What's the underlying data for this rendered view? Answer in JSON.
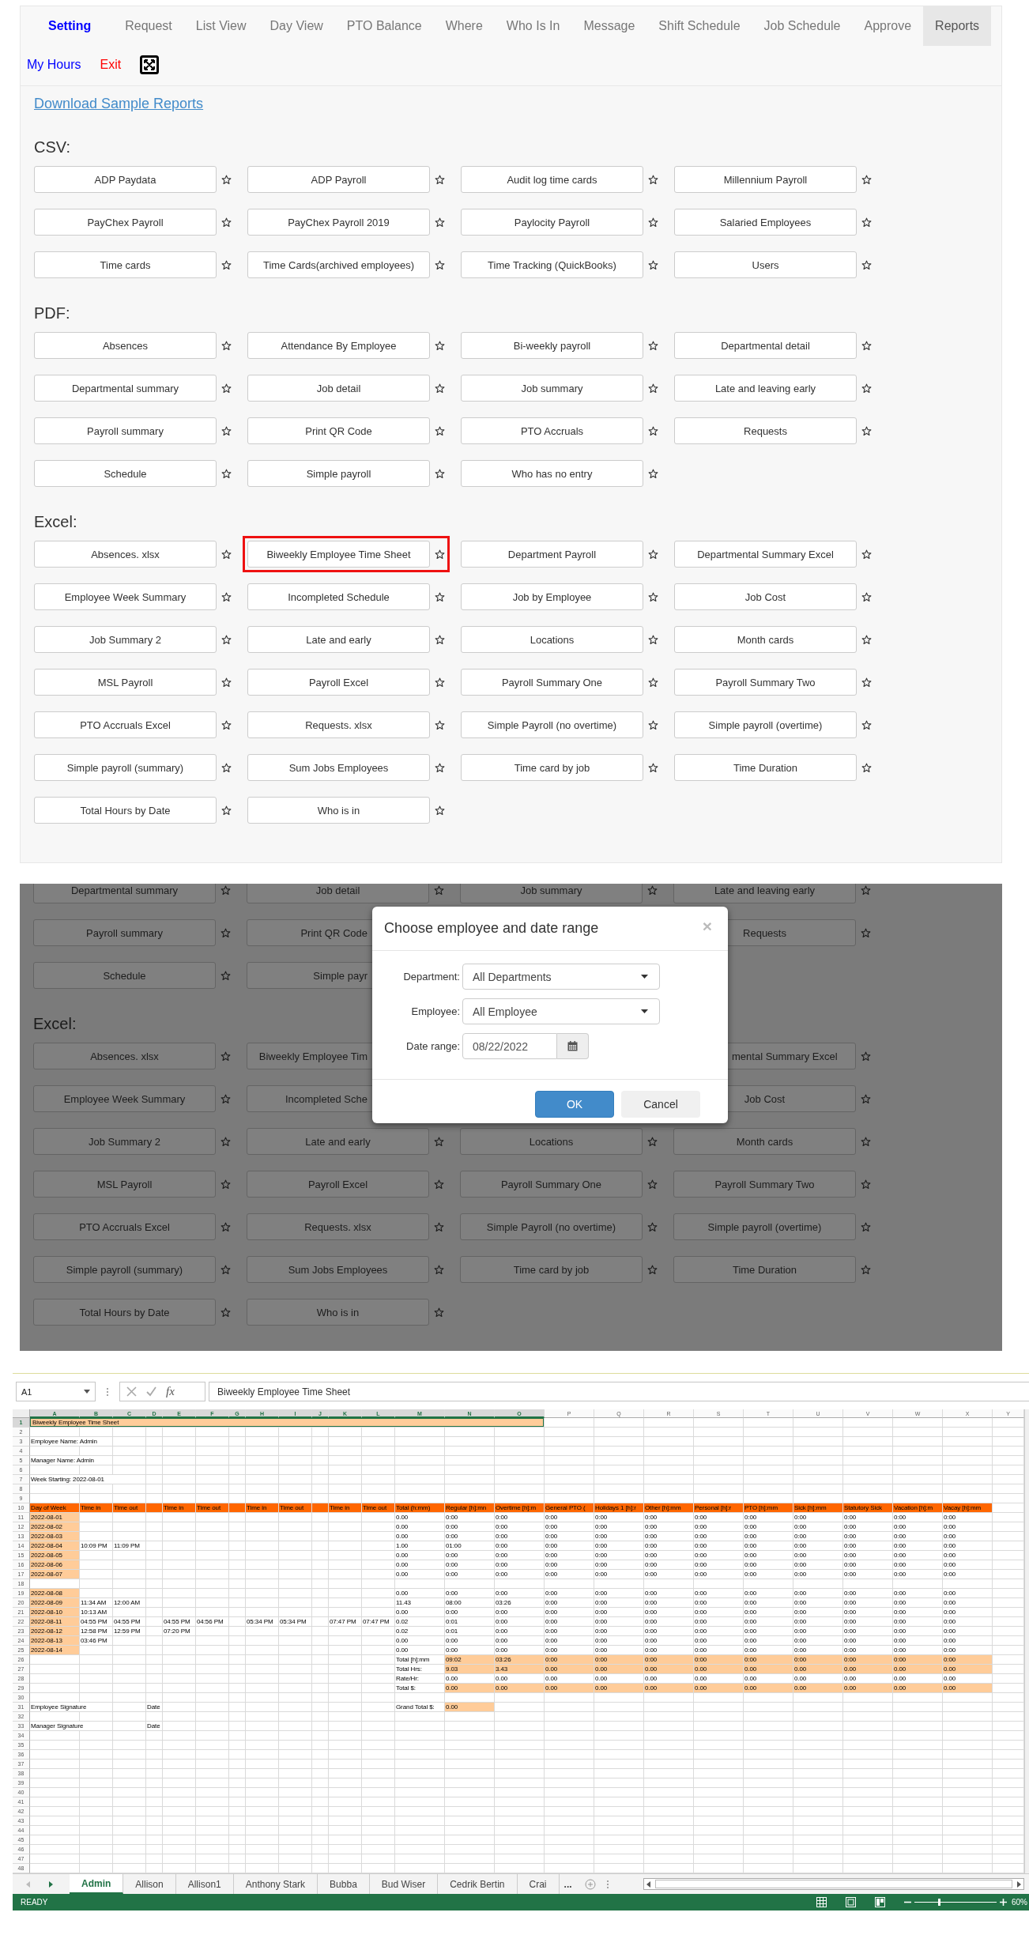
{
  "nav": {
    "tabs": [
      {
        "label": "Setting",
        "kind": "brand",
        "selected": false
      },
      {
        "label": "Request",
        "kind": "tab",
        "selected": false
      },
      {
        "label": "List View",
        "kind": "tab",
        "selected": false
      },
      {
        "label": "Day View",
        "kind": "tab",
        "selected": false
      },
      {
        "label": "PTO Balance",
        "kind": "tab",
        "selected": false
      },
      {
        "label": "Where",
        "kind": "tab",
        "selected": false
      },
      {
        "label": "Who Is In",
        "kind": "tab",
        "selected": false
      },
      {
        "label": "Message",
        "kind": "tab",
        "selected": false
      },
      {
        "label": "Shift Schedule",
        "kind": "tab",
        "selected": false
      },
      {
        "label": "Job Schedule",
        "kind": "tab",
        "selected": false
      },
      {
        "label": "Approve",
        "kind": "tab",
        "selected": false
      },
      {
        "label": "Reports",
        "kind": "tab",
        "selected": true
      }
    ],
    "links": [
      {
        "label": "My Hours",
        "color": "#0000ff"
      },
      {
        "label": "Exit",
        "color": "#ff0000"
      }
    ]
  },
  "reports_page": {
    "download_link": "Download Sample Reports",
    "sections": [
      {
        "heading": "CSV:",
        "reports": [
          {
            "label": "ADP Paydata"
          },
          {
            "label": "ADP Payroll"
          },
          {
            "label": "Audit log time cards"
          },
          {
            "label": "Millennium Payroll"
          },
          {
            "label": "PayChex Payroll"
          },
          {
            "label": "PayChex Payroll 2019"
          },
          {
            "label": "Paylocity Payroll"
          },
          {
            "label": "Salaried Employees"
          },
          {
            "label": "Time cards"
          },
          {
            "label": "Time Cards(archived employees)"
          },
          {
            "label": "Time Tracking (QuickBooks)"
          },
          {
            "label": "Users"
          }
        ]
      },
      {
        "heading": "PDF:",
        "reports": [
          {
            "label": "Absences"
          },
          {
            "label": "Attendance By Employee"
          },
          {
            "label": "Bi-weekly payroll"
          },
          {
            "label": "Departmental detail"
          },
          {
            "label": "Departmental summary"
          },
          {
            "label": "Job detail"
          },
          {
            "label": "Job summary"
          },
          {
            "label": "Late and leaving early"
          },
          {
            "label": "Payroll summary"
          },
          {
            "label": "Print QR Code"
          },
          {
            "label": "PTO Accruals"
          },
          {
            "label": "Requests"
          },
          {
            "label": "Schedule"
          },
          {
            "label": "Simple payroll"
          },
          {
            "label": "Who has no entry"
          }
        ]
      },
      {
        "heading": "Excel:",
        "reports": [
          {
            "label": "Absences. xlsx",
            "outlined": false
          },
          {
            "label": "Biweekly Employee Time Sheet",
            "outlined": true
          },
          {
            "label": "Department Payroll",
            "outlined": false
          },
          {
            "label": "Departmental Summary Excel",
            "outlined": false
          },
          {
            "label": "Employee Week Summary",
            "outlined": false
          },
          {
            "label": "Incompleted Schedule",
            "outlined": false
          },
          {
            "label": "Job by Employee",
            "outlined": false
          },
          {
            "label": "Job Cost",
            "outlined": false
          },
          {
            "label": "Job Summary 2",
            "outlined": false
          },
          {
            "label": "Late and early",
            "outlined": false
          },
          {
            "label": "Locations",
            "outlined": false
          },
          {
            "label": "Month cards",
            "outlined": false
          },
          {
            "label": "MSL Payroll",
            "outlined": false
          },
          {
            "label": "Payroll Excel",
            "outlined": false
          },
          {
            "label": "Payroll Summary One",
            "outlined": false
          },
          {
            "label": "Payroll Summary Two",
            "outlined": false
          },
          {
            "label": "PTO Accruals Excel",
            "outlined": false
          },
          {
            "label": "Requests. xlsx",
            "outlined": false
          },
          {
            "label": "Simple Payroll (no overtime)",
            "outlined": false
          },
          {
            "label": "Simple payroll (overtime)",
            "outlined": false
          },
          {
            "label": "Simple payroll (summary)",
            "outlined": false
          },
          {
            "label": "Sum Jobs Employees",
            "outlined": false
          },
          {
            "label": "Time card by job",
            "outlined": false
          },
          {
            "label": "Time Duration",
            "outlined": false
          },
          {
            "label": "Total Hours by Date",
            "outlined": false
          },
          {
            "label": "Who is in",
            "outlined": false
          }
        ]
      }
    ]
  },
  "background_page": {
    "sections": [
      {
        "reports": [
          {
            "label": "Departmental summary",
            "kind": "plain"
          },
          {
            "label": "Job detail",
            "kind": "plain"
          },
          {
            "label": "Job summary",
            "kind": "plain"
          },
          {
            "label": "Late and leaving early",
            "kind": "plain"
          },
          {
            "label": "Payroll summary",
            "kind": "plain"
          },
          {
            "label": "Print QR Code",
            "kind": "right-covered"
          },
          {
            "kind": "covered"
          },
          {
            "label": "Requests",
            "kind": "plain"
          },
          {
            "label": "Schedule",
            "kind": "plain"
          },
          {
            "label": "Simple payr",
            "kind": "right-covered"
          },
          {
            "kind": "covered"
          }
        ]
      },
      {
        "heading": "Excel:",
        "reports": [
          {
            "label": "Absences. xlsx",
            "kind": "plain"
          },
          {
            "label": "Biweekly Employee Tim",
            "kind": "right-covered"
          },
          {
            "kind": "covered"
          },
          {
            "label": "mental Summary Excel",
            "kind": "left-covered"
          },
          {
            "label": "Employee Week Summary",
            "kind": "plain"
          },
          {
            "label": "Incompleted Sche",
            "kind": "right-covered"
          },
          {
            "kind": "covered"
          },
          {
            "label": "Job Cost",
            "kind": "plain"
          },
          {
            "label": "Job Summary 2",
            "kind": "plain"
          },
          {
            "label": "Late and early",
            "kind": "plain"
          },
          {
            "label": "Locations",
            "kind": "plain"
          },
          {
            "label": "Month cards",
            "kind": "plain"
          },
          {
            "label": "MSL Payroll",
            "kind": "plain"
          },
          {
            "label": "Payroll Excel",
            "kind": "plain"
          },
          {
            "label": "Payroll Summary One",
            "kind": "plain"
          },
          {
            "label": "Payroll Summary Two",
            "kind": "plain"
          },
          {
            "label": "PTO Accruals Excel",
            "kind": "plain"
          },
          {
            "label": "Requests. xlsx",
            "kind": "plain"
          },
          {
            "label": "Simple Payroll (no overtime)",
            "kind": "plain"
          },
          {
            "label": "Simple payroll (overtime)",
            "kind": "plain"
          },
          {
            "label": "Simple payroll (summary)",
            "kind": "plain"
          },
          {
            "label": "Sum Jobs Employees",
            "kind": "plain"
          },
          {
            "label": "Time card by job",
            "kind": "plain"
          },
          {
            "label": "Time Duration",
            "kind": "plain"
          },
          {
            "label": "Total Hours by Date",
            "kind": "plain"
          },
          {
            "label": "Who is in",
            "kind": "plain"
          }
        ]
      }
    ]
  },
  "dialog": {
    "title": "Choose employee and date range",
    "close": "×",
    "fields": [
      {
        "label": "Department:",
        "kind": "select",
        "value": "All Departments"
      },
      {
        "label": "Employee:",
        "kind": "select",
        "value": "All Employee"
      },
      {
        "label": "Date range:",
        "kind": "date",
        "value": "08/22/2022"
      }
    ],
    "buttons": [
      {
        "label": "OK",
        "kind": "primary"
      },
      {
        "label": "Cancel",
        "kind": "default"
      }
    ]
  },
  "spreadsheet": {
    "name_box": "A1",
    "function_label": "fx",
    "formula": "Biweekly Employee Time Sheet",
    "columns": [
      {
        "label": "A",
        "selected": true
      },
      {
        "label": "B",
        "selected": true
      },
      {
        "label": "C",
        "selected": true
      },
      {
        "label": "D",
        "selected": true
      },
      {
        "label": "E",
        "selected": true
      },
      {
        "label": "F",
        "selected": true
      },
      {
        "label": "G",
        "selected": true
      },
      {
        "label": "H",
        "selected": true
      },
      {
        "label": "I",
        "selected": true
      },
      {
        "label": "J",
        "selected": true
      },
      {
        "label": "K",
        "selected": true
      },
      {
        "label": "L",
        "selected": true
      },
      {
        "label": "M",
        "selected": true
      },
      {
        "label": "N",
        "selected": true
      },
      {
        "label": "O",
        "selected": true
      },
      {
        "label": "P",
        "selected": false
      },
      {
        "label": "Q",
        "selected": false
      },
      {
        "label": "R",
        "selected": false
      },
      {
        "label": "S",
        "selected": false
      },
      {
        "label": "T",
        "selected": false
      },
      {
        "label": "U",
        "selected": false
      },
      {
        "label": "V",
        "selected": false
      },
      {
        "label": "W",
        "selected": false
      },
      {
        "label": "X",
        "selected": false
      },
      {
        "label": "Y",
        "selected": false
      }
    ],
    "rows": [
      {
        "label": "1",
        "selected": true,
        "cells": [
          {
            "text": "Biweekly Employee Time Sheet",
            "color": "#ffcc99",
            "selected": true
          },
          {
            "kind": "merged"
          },
          {
            "kind": "merged"
          },
          {
            "kind": "merged"
          },
          {
            "kind": "merged"
          },
          {
            "kind": "merged"
          },
          {
            "kind": "merged"
          },
          {
            "kind": "merged"
          },
          {
            "kind": "merged"
          },
          {
            "kind": "merged"
          },
          {
            "kind": "merged"
          },
          {
            "kind": "merged"
          },
          {
            "kind": "merged"
          },
          {
            "kind": "merged"
          },
          {
            "kind": "merged"
          }
        ]
      },
      {
        "label": "2",
        "selected": false
      },
      {
        "label": "3",
        "selected": false,
        "cells": [
          {
            "text": "Employee Name: Admin"
          }
        ]
      },
      {
        "label": "4",
        "selected": false
      },
      {
        "label": "5",
        "selected": false,
        "cells": [
          {
            "text": "Manager Name: Admin"
          }
        ]
      },
      {
        "label": "6",
        "selected": false
      },
      {
        "label": "7",
        "selected": false,
        "cells": [
          {
            "text": "Week Starting: 2022-08-01"
          }
        ]
      },
      {
        "label": "8",
        "selected": false
      },
      {
        "label": "9",
        "selected": false
      },
      {
        "label": "10",
        "selected": false,
        "cells": [
          {
            "text": "Day of Week",
            "color": "#ff6600"
          },
          {
            "text": "Time in",
            "color": "#ff6600"
          },
          {
            "text": "Time out",
            "color": "#ff6600"
          },
          {
            "color": "#ff6600"
          },
          {
            "text": "Time in",
            "color": "#ff6600"
          },
          {
            "text": "Time out",
            "color": "#ff6600"
          },
          {
            "color": "#ff6600"
          },
          {
            "text": "Time in",
            "color": "#ff6600"
          },
          {
            "text": "Time out",
            "color": "#ff6600"
          },
          {
            "color": "#ff6600"
          },
          {
            "text": "Time in",
            "color": "#ff6600"
          },
          {
            "text": "Time out",
            "color": "#ff6600"
          },
          {
            "text": "Total (h:mm)",
            "color": "#ff6600"
          },
          {
            "text": "Regular [h]:mn",
            "color": "#ff6600"
          },
          {
            "text": "Overtime [h]:m",
            "color": "#ff6600"
          },
          {
            "text": "General PTO (",
            "color": "#ff6600"
          },
          {
            "text": "Holidays 1 [h]:r",
            "color": "#ff6600"
          },
          {
            "text": "Other [h]:mm",
            "color": "#ff6600"
          },
          {
            "text": "Personal [h]:r",
            "color": "#ff6600"
          },
          {
            "text": "PTO [h]:mm",
            "color": "#ff6600"
          },
          {
            "text": "Sick [h]:mm",
            "color": "#ff6600"
          },
          {
            "text": "Statutory Sick",
            "color": "#ff6600"
          },
          {
            "text": "Vacation [h]:m",
            "color": "#ff6600"
          },
          {
            "text": "Vacay [h]:mm",
            "color": "#ff6600"
          }
        ]
      },
      {
        "label": "11",
        "selected": false,
        "cells": [
          {
            "text": "2022-08-01",
            "color": "#ffcc99"
          },
          null,
          null,
          null,
          null,
          null,
          null,
          null,
          null,
          null,
          null,
          null,
          {
            "text": "0.00"
          },
          {
            "text": "0:00"
          },
          {
            "text": "0:00"
          },
          {
            "text": "0:00"
          },
          {
            "text": "0:00"
          },
          {
            "text": "0:00"
          },
          {
            "text": "0:00"
          },
          {
            "text": "0:00"
          },
          {
            "text": "0:00"
          },
          {
            "text": "0:00"
          },
          {
            "text": "0:00"
          },
          {
            "text": "0:00"
          }
        ]
      },
      {
        "label": "12",
        "selected": false,
        "cells": [
          {
            "text": "2022-08-02",
            "color": "#ffcc99"
          },
          null,
          null,
          null,
          null,
          null,
          null,
          null,
          null,
          null,
          null,
          null,
          {
            "text": "0.00"
          },
          {
            "text": "0:00"
          },
          {
            "text": "0:00"
          },
          {
            "text": "0:00"
          },
          {
            "text": "0:00"
          },
          {
            "text": "0:00"
          },
          {
            "text": "0:00"
          },
          {
            "text": "0:00"
          },
          {
            "text": "0:00"
          },
          {
            "text": "0:00"
          },
          {
            "text": "0:00"
          },
          {
            "text": "0:00"
          }
        ]
      },
      {
        "label": "13",
        "selected": false,
        "cells": [
          {
            "text": "2022-08-03",
            "color": "#ffcc99"
          },
          null,
          null,
          null,
          null,
          null,
          null,
          null,
          null,
          null,
          null,
          null,
          {
            "text": "0.00"
          },
          {
            "text": "0:00"
          },
          {
            "text": "0:00"
          },
          {
            "text": "0:00"
          },
          {
            "text": "0:00"
          },
          {
            "text": "0:00"
          },
          {
            "text": "0:00"
          },
          {
            "text": "0:00"
          },
          {
            "text": "0:00"
          },
          {
            "text": "0:00"
          },
          {
            "text": "0:00"
          },
          {
            "text": "0:00"
          }
        ]
      },
      {
        "label": "14",
        "selected": false,
        "cells": [
          {
            "text": "2022-08-04",
            "color": "#ffcc99"
          },
          {
            "text": "10:09 PM"
          },
          {
            "text": "11:09 PM"
          },
          null,
          null,
          null,
          null,
          null,
          null,
          null,
          null,
          null,
          {
            "text": "1.00"
          },
          {
            "text": "01:00"
          },
          {
            "text": "0:00"
          },
          {
            "text": "0:00"
          },
          {
            "text": "0:00"
          },
          {
            "text": "0:00"
          },
          {
            "text": "0:00"
          },
          {
            "text": "0:00"
          },
          {
            "text": "0:00"
          },
          {
            "text": "0:00"
          },
          {
            "text": "0:00"
          },
          {
            "text": "0:00"
          }
        ]
      },
      {
        "label": "15",
        "selected": false,
        "cells": [
          {
            "text": "2022-08-05",
            "color": "#ffcc99"
          },
          null,
          null,
          null,
          null,
          null,
          null,
          null,
          null,
          null,
          null,
          null,
          {
            "text": "0.00"
          },
          {
            "text": "0:00"
          },
          {
            "text": "0:00"
          },
          {
            "text": "0:00"
          },
          {
            "text": "0:00"
          },
          {
            "text": "0:00"
          },
          {
            "text": "0:00"
          },
          {
            "text": "0:00"
          },
          {
            "text": "0:00"
          },
          {
            "text": "0:00"
          },
          {
            "text": "0:00"
          },
          {
            "text": "0:00"
          }
        ]
      },
      {
        "label": "16",
        "selected": false,
        "cells": [
          {
            "text": "2022-08-06",
            "color": "#ffcc99"
          },
          null,
          null,
          null,
          null,
          null,
          null,
          null,
          null,
          null,
          null,
          null,
          {
            "text": "0.00"
          },
          {
            "text": "0:00"
          },
          {
            "text": "0:00"
          },
          {
            "text": "0:00"
          },
          {
            "text": "0:00"
          },
          {
            "text": "0:00"
          },
          {
            "text": "0:00"
          },
          {
            "text": "0:00"
          },
          {
            "text": "0:00"
          },
          {
            "text": "0:00"
          },
          {
            "text": "0:00"
          },
          {
            "text": "0:00"
          }
        ]
      },
      {
        "label": "17",
        "selected": false,
        "cells": [
          {
            "text": "2022-08-07",
            "color": "#ffcc99"
          },
          null,
          null,
          null,
          null,
          null,
          null,
          null,
          null,
          null,
          null,
          null,
          {
            "text": "0.00"
          },
          {
            "text": "0:00"
          },
          {
            "text": "0:00"
          },
          {
            "text": "0:00"
          },
          {
            "text": "0:00"
          },
          {
            "text": "0:00"
          },
          {
            "text": "0:00"
          },
          {
            "text": "0:00"
          },
          {
            "text": "0:00"
          },
          {
            "text": "0:00"
          },
          {
            "text": "0:00"
          },
          {
            "text": "0:00"
          }
        ]
      },
      {
        "label": "18",
        "selected": false
      },
      {
        "label": "19",
        "selected": false,
        "cells": [
          {
            "text": "2022-08-08",
            "color": "#ffcc99"
          },
          null,
          null,
          null,
          null,
          null,
          null,
          null,
          null,
          null,
          null,
          null,
          {
            "text": "0.00"
          },
          {
            "text": "0:00"
          },
          {
            "text": "0:00"
          },
          {
            "text": "0:00"
          },
          {
            "text": "0:00"
          },
          {
            "text": "0:00"
          },
          {
            "text": "0:00"
          },
          {
            "text": "0:00"
          },
          {
            "text": "0:00"
          },
          {
            "text": "0:00"
          },
          {
            "text": "0:00"
          },
          {
            "text": "0:00"
          }
        ]
      },
      {
        "label": "20",
        "selected": false,
        "cells": [
          {
            "text": "2022-08-09",
            "color": "#ffcc99"
          },
          {
            "text": "11:34 AM"
          },
          {
            "text": "12:00 AM"
          },
          null,
          null,
          null,
          null,
          null,
          null,
          null,
          null,
          null,
          {
            "text": "11.43"
          },
          {
            "text": "08:00"
          },
          {
            "text": "03:26"
          },
          {
            "text": "0:00"
          },
          {
            "text": "0:00"
          },
          {
            "text": "0:00"
          },
          {
            "text": "0:00"
          },
          {
            "text": "0:00"
          },
          {
            "text": "0:00"
          },
          {
            "text": "0:00"
          },
          {
            "text": "0:00"
          },
          {
            "text": "0:00"
          }
        ]
      },
      {
        "label": "21",
        "selected": false,
        "cells": [
          {
            "text": "2022-08-10",
            "color": "#ffcc99"
          },
          {
            "text": "10:13 AM"
          },
          null,
          null,
          null,
          null,
          null,
          null,
          null,
          null,
          null,
          null,
          {
            "text": "0.00"
          },
          {
            "text": "0:00"
          },
          {
            "text": "0:00"
          },
          {
            "text": "0:00"
          },
          {
            "text": "0:00"
          },
          {
            "text": "0:00"
          },
          {
            "text": "0:00"
          },
          {
            "text": "0:00"
          },
          {
            "text": "0:00"
          },
          {
            "text": "0:00"
          },
          {
            "text": "0:00"
          },
          {
            "text": "0:00"
          }
        ]
      },
      {
        "label": "22",
        "selected": false,
        "cells": [
          {
            "text": "2022-08-11",
            "color": "#ffcc99"
          },
          {
            "text": "04:55 PM"
          },
          {
            "text": "04:55 PM"
          },
          null,
          {
            "text": "04:55 PM"
          },
          {
            "text": "04:56 PM"
          },
          null,
          {
            "text": "05:34 PM"
          },
          {
            "text": "05:34 PM"
          },
          null,
          {
            "text": "07:47 PM"
          },
          {
            "text": "07:47 PM"
          },
          {
            "text": "0.02"
          },
          {
            "text": "0:01"
          },
          {
            "text": "0:00"
          },
          {
            "text": "0:00"
          },
          {
            "text": "0:00"
          },
          {
            "text": "0:00"
          },
          {
            "text": "0:00"
          },
          {
            "text": "0:00"
          },
          {
            "text": "0:00"
          },
          {
            "text": "0:00"
          },
          {
            "text": "0:00"
          },
          {
            "text": "0:00"
          }
        ]
      },
      {
        "label": "23",
        "selected": false,
        "cells": [
          {
            "text": "2022-08-12",
            "color": "#ffcc99"
          },
          {
            "text": "12:58 PM"
          },
          {
            "text": "12:59 PM"
          },
          null,
          {
            "text": "07:20 PM"
          },
          null,
          null,
          null,
          null,
          null,
          null,
          null,
          {
            "text": "0.02"
          },
          {
            "text": "0:01"
          },
          {
            "text": "0:00"
          },
          {
            "text": "0:00"
          },
          {
            "text": "0:00"
          },
          {
            "text": "0:00"
          },
          {
            "text": "0:00"
          },
          {
            "text": "0:00"
          },
          {
            "text": "0:00"
          },
          {
            "text": "0:00"
          },
          {
            "text": "0:00"
          },
          {
            "text": "0:00"
          }
        ]
      },
      {
        "label": "24",
        "selected": false,
        "cells": [
          {
            "text": "2022-08-13",
            "color": "#ffcc99"
          },
          {
            "text": "03:46 PM"
          },
          null,
          null,
          null,
          null,
          null,
          null,
          null,
          null,
          null,
          null,
          {
            "text": "0.00"
          },
          {
            "text": "0:00"
          },
          {
            "text": "0:00"
          },
          {
            "text": "0:00"
          },
          {
            "text": "0:00"
          },
          {
            "text": "0:00"
          },
          {
            "text": "0:00"
          },
          {
            "text": "0:00"
          },
          {
            "text": "0:00"
          },
          {
            "text": "0:00"
          },
          {
            "text": "0:00"
          },
          {
            "text": "0:00"
          }
        ]
      },
      {
        "label": "25",
        "selected": false,
        "cells": [
          {
            "text": "2022-08-14",
            "color": "#ffcc99"
          },
          null,
          null,
          null,
          null,
          null,
          null,
          null,
          null,
          null,
          null,
          null,
          {
            "text": "0.00"
          },
          {
            "text": "0:00"
          },
          {
            "text": "0:00"
          },
          {
            "text": "0:00"
          },
          {
            "text": "0:00"
          },
          {
            "text": "0:00"
          },
          {
            "text": "0:00"
          },
          {
            "text": "0:00"
          },
          {
            "text": "0:00"
          },
          {
            "text": "0:00"
          },
          {
            "text": "0:00"
          },
          {
            "text": "0:00"
          }
        ]
      },
      {
        "label": "26",
        "selected": false,
        "cells": [
          null,
          null,
          null,
          null,
          null,
          null,
          null,
          null,
          null,
          null,
          null,
          null,
          {
            "text": "Total [h]:mm"
          },
          {
            "text": "09:02",
            "color": "#ffcc99"
          },
          {
            "text": "03:26",
            "color": "#ffcc99"
          },
          {
            "text": "0:00",
            "color": "#ffcc99"
          },
          {
            "text": "0:00",
            "color": "#ffcc99"
          },
          {
            "text": "0:00",
            "color": "#ffcc99"
          },
          {
            "text": "0:00",
            "color": "#ffcc99"
          },
          {
            "text": "0:00",
            "color": "#ffcc99"
          },
          {
            "text": "0:00",
            "color": "#ffcc99"
          },
          {
            "text": "0:00",
            "color": "#ffcc99"
          },
          {
            "text": "0:00",
            "color": "#ffcc99"
          },
          {
            "text": "0:00",
            "color": "#ffcc99"
          }
        ]
      },
      {
        "label": "27",
        "selected": false,
        "cells": [
          null,
          null,
          null,
          null,
          null,
          null,
          null,
          null,
          null,
          null,
          null,
          null,
          {
            "text": "Total Hrs:"
          },
          {
            "text": "9.03",
            "color": "#ffcc99"
          },
          {
            "text": "3.43",
            "color": "#ffcc99"
          },
          {
            "text": "0.00",
            "color": "#ffcc99"
          },
          {
            "text": "0.00",
            "color": "#ffcc99"
          },
          {
            "text": "0.00",
            "color": "#ffcc99"
          },
          {
            "text": "0.00",
            "color": "#ffcc99"
          },
          {
            "text": "0.00",
            "color": "#ffcc99"
          },
          {
            "text": "0.00",
            "color": "#ffcc99"
          },
          {
            "text": "0.00",
            "color": "#ffcc99"
          },
          {
            "text": "0.00",
            "color": "#ffcc99"
          },
          {
            "text": "0.00",
            "color": "#ffcc99"
          }
        ]
      },
      {
        "label": "28",
        "selected": false,
        "cells": [
          null,
          null,
          null,
          null,
          null,
          null,
          null,
          null,
          null,
          null,
          null,
          null,
          {
            "text": "Rate/Hr:"
          },
          {
            "text": "0.00"
          },
          {
            "text": "0.00"
          },
          {
            "text": "0.00"
          },
          {
            "text": "0.00"
          },
          {
            "text": "0.00"
          },
          {
            "text": "0.00"
          },
          {
            "text": "0.00"
          },
          {
            "text": "0.00"
          },
          {
            "text": "0.00"
          },
          {
            "text": "0.00"
          },
          {
            "text": "0.00"
          }
        ]
      },
      {
        "label": "29",
        "selected": false,
        "cells": [
          null,
          null,
          null,
          null,
          null,
          null,
          null,
          null,
          null,
          null,
          null,
          null,
          {
            "text": "Total $:"
          },
          {
            "text": "0.00",
            "color": "#ffcc99"
          },
          {
            "text": "0.00",
            "color": "#ffcc99"
          },
          {
            "text": "0.00",
            "color": "#ffcc99"
          },
          {
            "text": "0.00",
            "color": "#ffcc99"
          },
          {
            "text": "0.00",
            "color": "#ffcc99"
          },
          {
            "text": "0.00",
            "color": "#ffcc99"
          },
          {
            "text": "0.00",
            "color": "#ffcc99"
          },
          {
            "text": "0.00",
            "color": "#ffcc99"
          },
          {
            "text": "0.00",
            "color": "#ffcc99"
          },
          {
            "text": "0.00",
            "color": "#ffcc99"
          },
          {
            "text": "0.00",
            "color": "#ffcc99"
          }
        ]
      },
      {
        "label": "30",
        "selected": false
      },
      {
        "label": "31",
        "selected": false,
        "cells": [
          {
            "text": "Employee Signature"
          },
          null,
          null,
          {
            "text": "Date"
          },
          null,
          null,
          null,
          null,
          null,
          null,
          null,
          null,
          {
            "text": "Grand Total $:"
          },
          {
            "text": "0.00",
            "color": "#ffcc99"
          }
        ]
      },
      {
        "label": "32",
        "selected": false
      },
      {
        "label": "33",
        "selected": false,
        "cells": [
          {
            "text": "Manager Signature"
          },
          null,
          null,
          {
            "text": "Date"
          }
        ]
      },
      {
        "label": "34",
        "selected": false
      },
      {
        "label": "35",
        "selected": false
      },
      {
        "label": "36",
        "selected": false
      },
      {
        "label": "37",
        "selected": false
      },
      {
        "label": "38",
        "selected": false
      },
      {
        "label": "39",
        "selected": false
      },
      {
        "label": "40",
        "selected": false
      },
      {
        "label": "41",
        "selected": false
      },
      {
        "label": "42",
        "selected": false
      },
      {
        "label": "43",
        "selected": false
      },
      {
        "label": "44",
        "selected": false
      },
      {
        "label": "45",
        "selected": false
      },
      {
        "label": "46",
        "selected": false
      },
      {
        "label": "47",
        "selected": false
      },
      {
        "label": "48",
        "selected": false
      }
    ],
    "sheet_tabs": [
      {
        "label": "Admin",
        "selected": true
      },
      {
        "label": "Allison",
        "selected": false
      },
      {
        "label": "Allison1",
        "selected": false
      },
      {
        "label": "Anthony Stark",
        "selected": false
      },
      {
        "label": "Bubba",
        "selected": false
      },
      {
        "label": "Bud Wiser",
        "selected": false
      },
      {
        "label": "Cedrik Bertin",
        "selected": false
      },
      {
        "label": "Crai",
        "selected": false
      }
    ],
    "more_tabs": "...",
    "status": "READY",
    "zoom_slider": {
      "level": 0.3
    },
    "zoom": "60%"
  }
}
